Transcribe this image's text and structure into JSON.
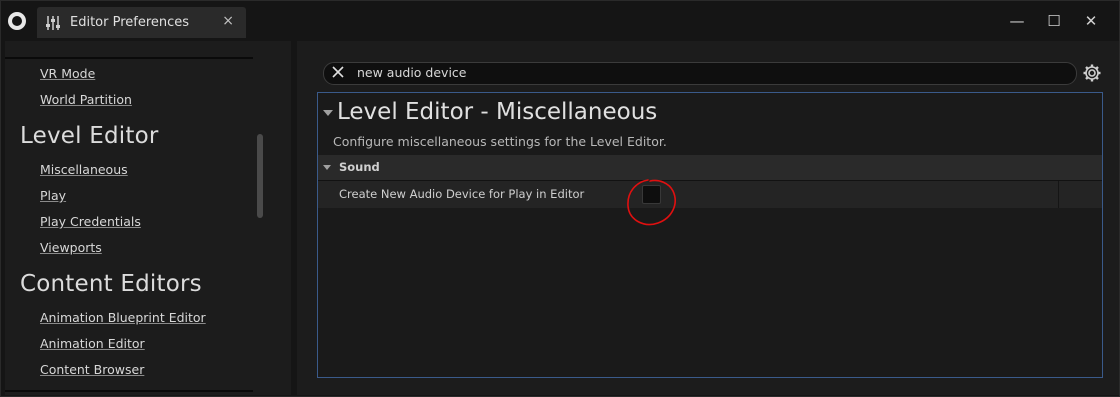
{
  "window": {
    "tab_title": "Editor Preferences",
    "tab_close": "×",
    "minimize": "—",
    "maximize": "☐",
    "close": "✕"
  },
  "sidebar": {
    "items_top": [
      {
        "label": "VR Mode"
      },
      {
        "label": "World Partition"
      }
    ],
    "section_level_editor": "Level Editor",
    "items_level_editor": [
      {
        "label": "Miscellaneous"
      },
      {
        "label": "Play"
      },
      {
        "label": "Play Credentials"
      },
      {
        "label": "Viewports"
      }
    ],
    "section_content_editors": "Content Editors",
    "items_content_editors": [
      {
        "label": "Animation Blueprint Editor"
      },
      {
        "label": "Animation Editor"
      },
      {
        "label": "Content Browser"
      }
    ]
  },
  "search": {
    "value": "new audio device"
  },
  "panel": {
    "title": "Level Editor - Miscellaneous",
    "description": "Configure miscellaneous settings for the Level Editor.",
    "category": "Sound",
    "property_label": "Create New Audio Device for Play in Editor",
    "property_checked": false
  },
  "colors": {
    "accent_border": "#3a5a8a",
    "annotation": "#e01010"
  }
}
